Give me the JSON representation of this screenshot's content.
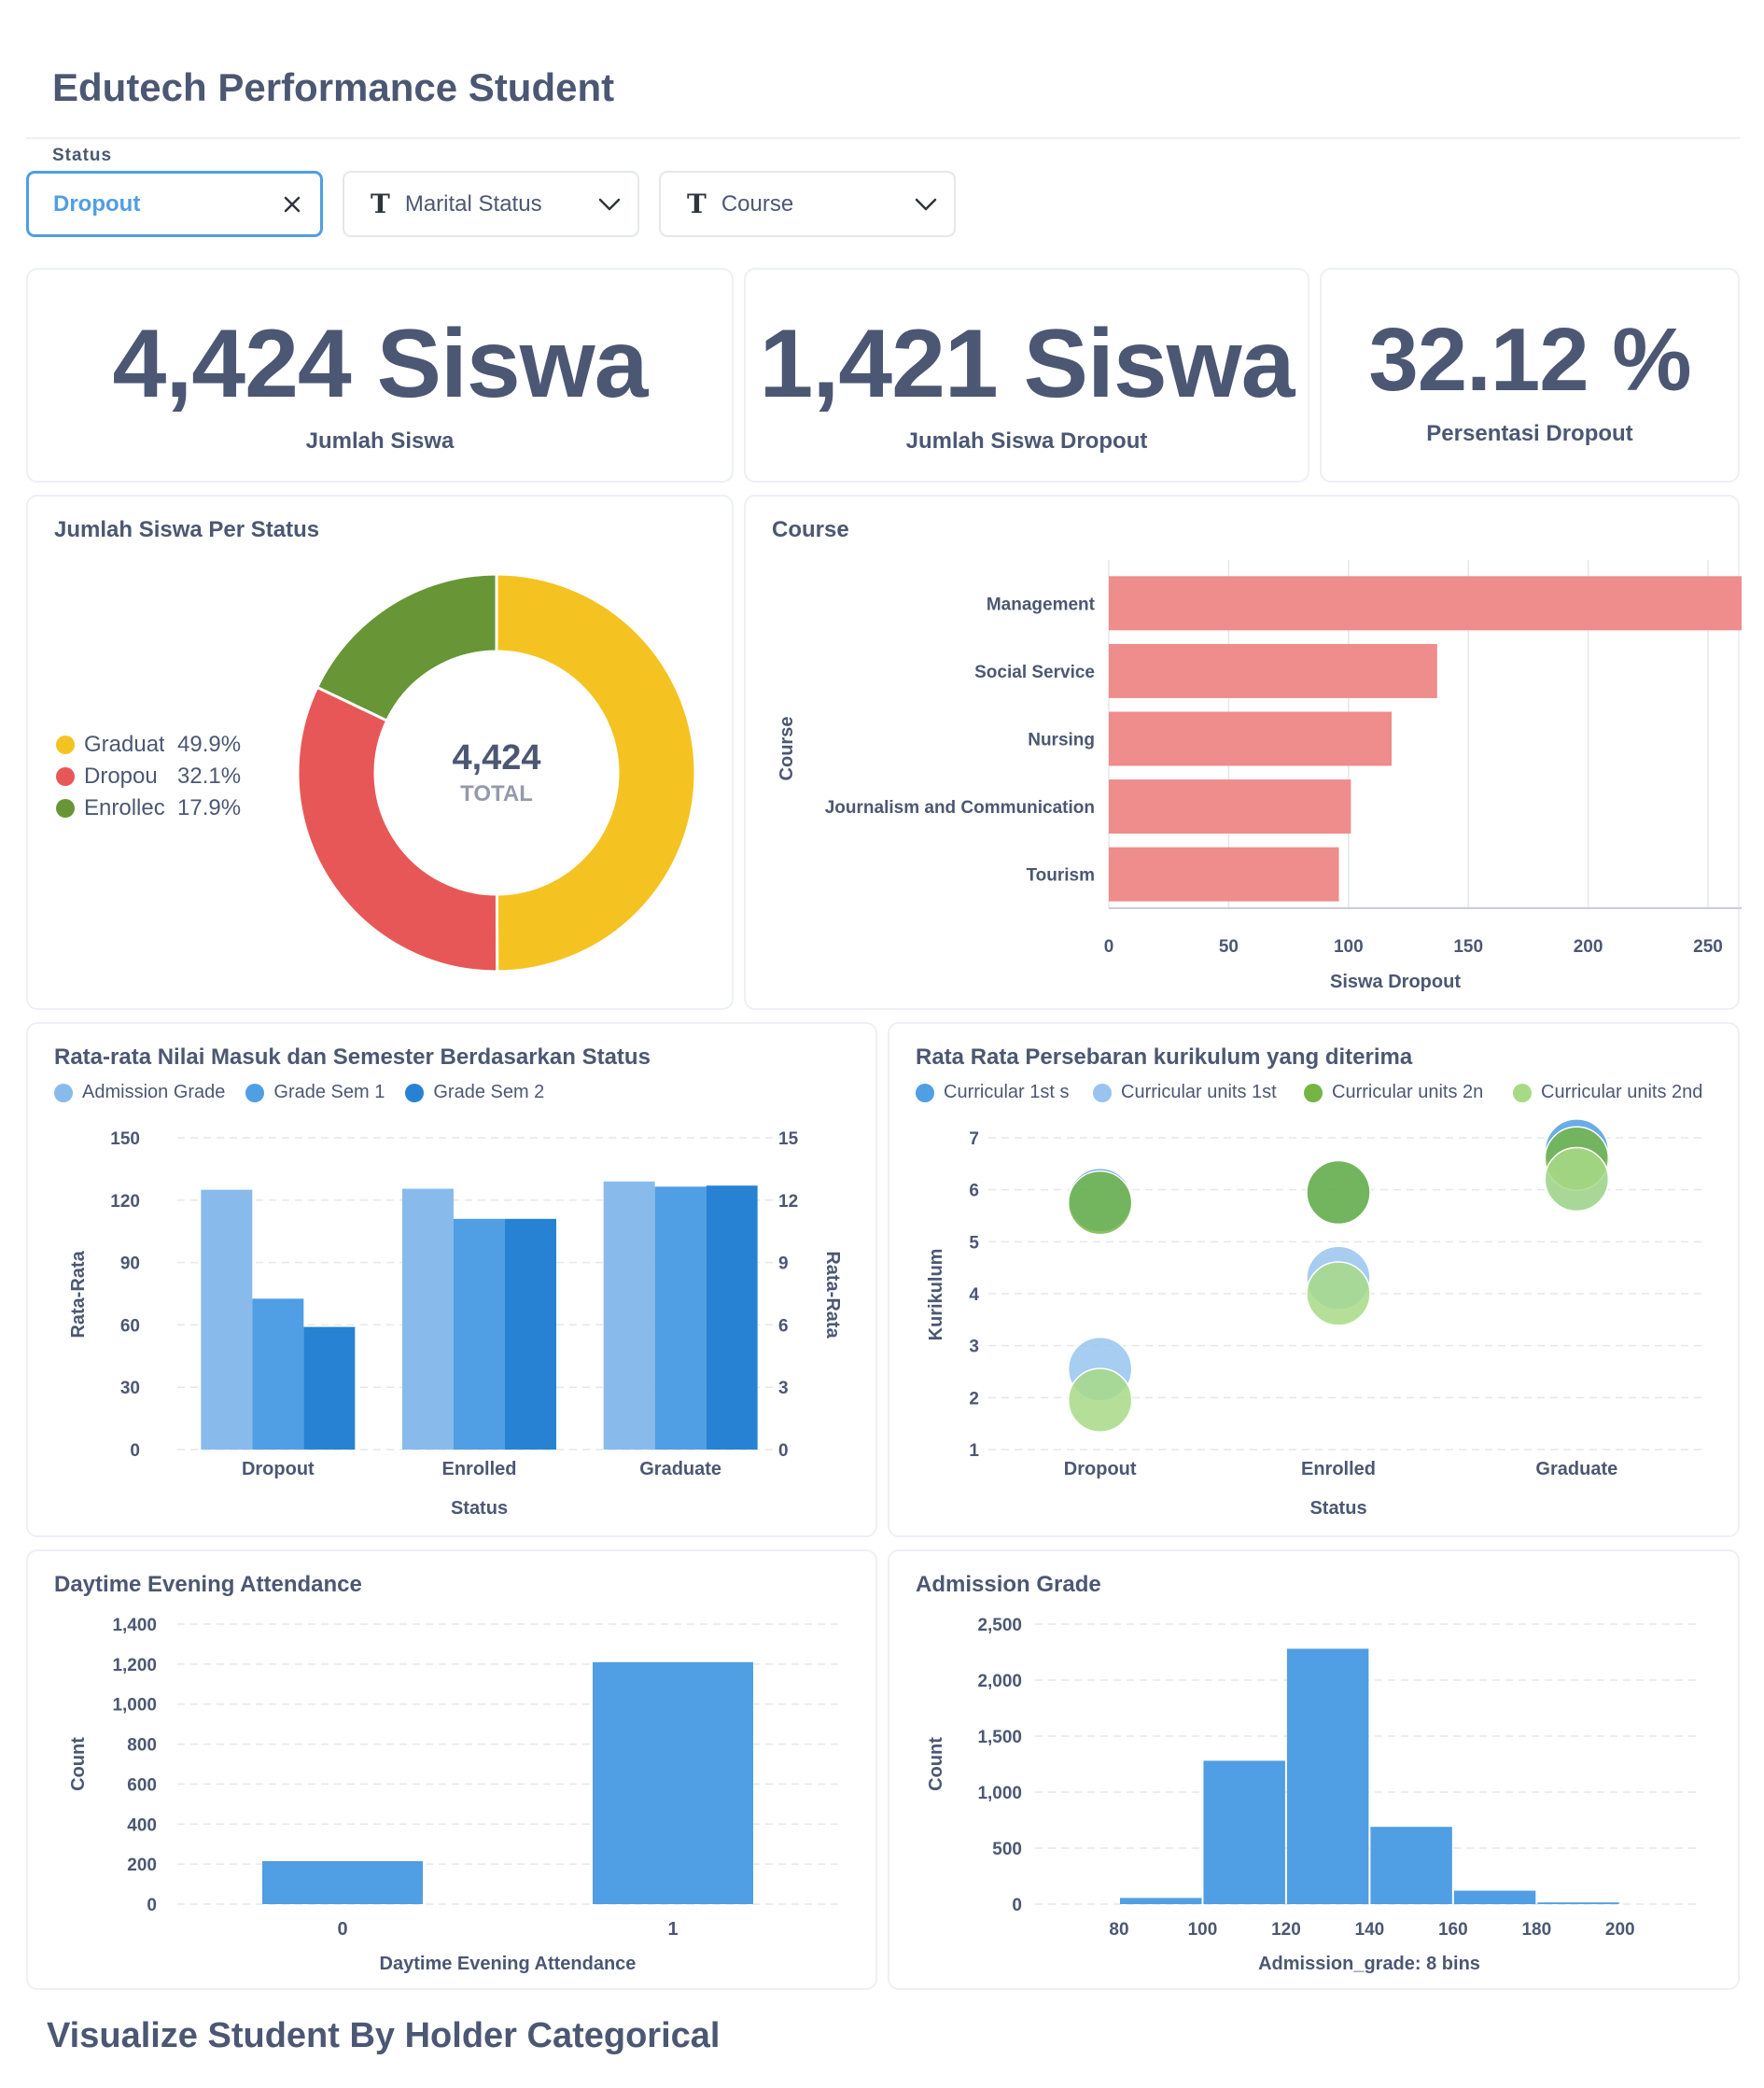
{
  "dashboard": {
    "title": "Edutech Performance Student",
    "bottom_section_title": "Visualize Student By Holder Categorical"
  },
  "filters": {
    "status": {
      "label": "Status",
      "value": "Dropout"
    },
    "marital": {
      "label": "Marital Status"
    },
    "course": {
      "label": "Course"
    }
  },
  "kpis": [
    {
      "value": "4,424 Siswa",
      "label": "Jumlah Siswa"
    },
    {
      "value": "1,421 Siswa",
      "label": "Jumlah Siswa Dropout"
    },
    {
      "value": "32.12 %",
      "label": "Persentasi Dropout"
    }
  ],
  "colors": {
    "accent": "#509ee3",
    "text": "#4c5773",
    "graduate": "#f5c321",
    "dropout": "#e85757",
    "enrolled": "#689636",
    "course_bar": "#ef8c8c",
    "bar_blue": "#509ee3"
  },
  "chart_data": [
    {
      "type": "pie",
      "title": "Jumlah Siswa Per Status",
      "center_value": "4,424",
      "center_label": "TOTAL",
      "categories": [
        "Graduate",
        "Dropout",
        "Enrolled"
      ],
      "legend_labels": [
        "Graduat",
        "Dropou",
        "Enrollec"
      ],
      "values": [
        49.9,
        32.1,
        17.9
      ],
      "value_labels": [
        "49.9%",
        "32.1%",
        "17.9%"
      ],
      "colors": [
        "#f5c321",
        "#e85757",
        "#689636"
      ]
    },
    {
      "type": "bar",
      "orientation": "horizontal",
      "title": "Course",
      "categories": [
        "Management",
        "Social Service",
        "Nursing",
        "Journalism and Communication",
        "Tourism"
      ],
      "values": [
        272,
        137,
        118,
        101,
        96
      ],
      "xlabel": "Siswa Dropout",
      "ylabel": "Course",
      "xlim": [
        0,
        280
      ],
      "xticks": [
        0,
        50,
        100,
        150,
        200,
        250
      ],
      "color": "#ef8c8c"
    },
    {
      "type": "bar",
      "title": "Rata-rata Nilai Masuk dan Semester Berdasarkan Status",
      "categories": [
        "Dropout",
        "Enrolled",
        "Graduate"
      ],
      "series": [
        {
          "name": "Admission Grade",
          "axis": "left",
          "values": [
            125,
            125.5,
            129
          ],
          "color": "#88bbec"
        },
        {
          "name": "Grade Sem 1",
          "axis": "right",
          "values": [
            7.26,
            11.1,
            12.65
          ],
          "color": "#509ee3"
        },
        {
          "name": "Grade Sem 2",
          "axis": "right",
          "values": [
            5.9,
            11.1,
            12.7
          ],
          "color": "#2782d4"
        }
      ],
      "xlabel": "Status",
      "ylabel": "Rata-Rata",
      "y2label": "Rata-Rata",
      "ylim": [
        0,
        150
      ],
      "y2lim": [
        0,
        15
      ],
      "yticks": [
        0,
        30,
        60,
        90,
        120,
        150
      ],
      "y2ticks": [
        0,
        3,
        6,
        9,
        12,
        15
      ]
    },
    {
      "type": "scatter",
      "title": "Rata Rata Persebaran kurikulum yang diterima",
      "categories": [
        "Dropout",
        "Enrolled",
        "Graduate"
      ],
      "series": [
        {
          "name": "Curricular 1st s",
          "values": [
            5.8,
            5.95,
            6.75
          ],
          "color": "#509ee3"
        },
        {
          "name": "Curricular units 1st",
          "values": [
            2.55,
            4.3,
            6.2
          ],
          "color": "#98c4ef"
        },
        {
          "name": "Curricular units 2n",
          "values": [
            5.75,
            5.95,
            6.6
          ],
          "color": "#74b545"
        },
        {
          "name": "Curricular units 2nd",
          "values": [
            1.95,
            4.0,
            6.2
          ],
          "color": "#a8d987"
        }
      ],
      "xlabel": "Status",
      "ylabel": "Kurikulum",
      "ylim": [
        1,
        7
      ],
      "yticks": [
        1,
        2,
        3,
        4,
        5,
        6,
        7
      ]
    },
    {
      "type": "bar",
      "title": "Daytime Evening Attendance",
      "categories": [
        "0",
        "1"
      ],
      "values": [
        215,
        1210
      ],
      "xlabel": "Daytime Evening Attendance",
      "ylabel": "Count",
      "ylim": [
        0,
        1400
      ],
      "yticks": [
        "0",
        "200",
        "400",
        "600",
        "800",
        "1,000",
        "1,200",
        "1,400"
      ],
      "color": "#509ee3"
    },
    {
      "type": "bar",
      "subtype": "histogram",
      "title": "Admission Grade",
      "bins": [
        [
          80,
          100
        ],
        [
          100,
          120
        ],
        [
          120,
          140
        ],
        [
          140,
          160
        ],
        [
          160,
          180
        ],
        [
          180,
          200
        ]
      ],
      "values": [
        55,
        1280,
        2280,
        690,
        120,
        15
      ],
      "xlabel": "Admission_grade: 8 bins",
      "ylabel": "Count",
      "xticks": [
        80,
        100,
        120,
        140,
        160,
        180,
        200
      ],
      "ylim": [
        0,
        2500
      ],
      "yticks": [
        "0",
        "500",
        "1,000",
        "1,500",
        "2,000",
        "2,500"
      ],
      "color": "#509ee3"
    }
  ]
}
